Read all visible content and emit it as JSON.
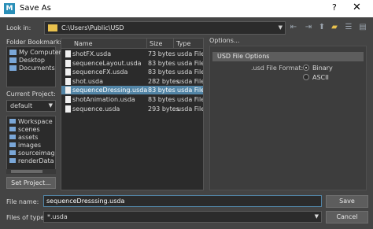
{
  "window": {
    "title": "Save As",
    "app_icon": "M",
    "help_glyph": "?",
    "close_glyph": "✕"
  },
  "lookin": {
    "label": "Look in:",
    "path": "C:\\Users\\Public\\USD"
  },
  "bookmarks": {
    "label": "Folder Bookmarks:",
    "items": [
      {
        "label": "My Computer",
        "icon": "computer-icon"
      },
      {
        "label": "Desktop",
        "icon": "desktop-icon"
      },
      {
        "label": "Documents",
        "icon": "documents-icon"
      }
    ]
  },
  "current_project": {
    "label": "Current Project:",
    "value": "default",
    "tree": [
      "Workspace F",
      "scenes",
      "assets",
      "images",
      "sourceimage",
      "renderData"
    ]
  },
  "set_project_label": "Set Project...",
  "file_list": {
    "columns": [
      "Name",
      "Size",
      "Type"
    ],
    "rows": [
      {
        "name": "shotFX.usda",
        "size": "73 bytes",
        "type": "usda File",
        "selected": false
      },
      {
        "name": "sequenceLayout.usda",
        "size": "83 bytes",
        "type": "usda File",
        "selected": false
      },
      {
        "name": "sequenceFX.usda",
        "size": "83 bytes",
        "type": "usda File",
        "selected": false
      },
      {
        "name": "shot.usda",
        "size": "282 bytes",
        "type": "usda File",
        "selected": false
      },
      {
        "name": "sequenceDressing.usda",
        "size": "83 bytes",
        "type": "usda File",
        "selected": true
      },
      {
        "name": "shotAnimation.usda",
        "size": "83 bytes",
        "type": "usda File",
        "selected": false
      },
      {
        "name": "sequence.usda",
        "size": "293 bytes",
        "type": "usda File",
        "selected": false
      }
    ]
  },
  "options": {
    "label": "Options...",
    "section": "USD File Options",
    "format_label": ".usd File Format:",
    "formats": [
      {
        "label": "Binary",
        "selected": true
      },
      {
        "label": "ASCII",
        "selected": false
      }
    ]
  },
  "file_name": {
    "label": "File name:",
    "value": "sequenceDresssing.usda"
  },
  "file_type": {
    "label": "Files of type:",
    "value": "*.usda"
  },
  "buttons": {
    "save": "Save",
    "cancel": "Cancel"
  },
  "colors": {
    "selection": "#5285a6",
    "folder": "#e9c14d",
    "background": "#444444"
  }
}
